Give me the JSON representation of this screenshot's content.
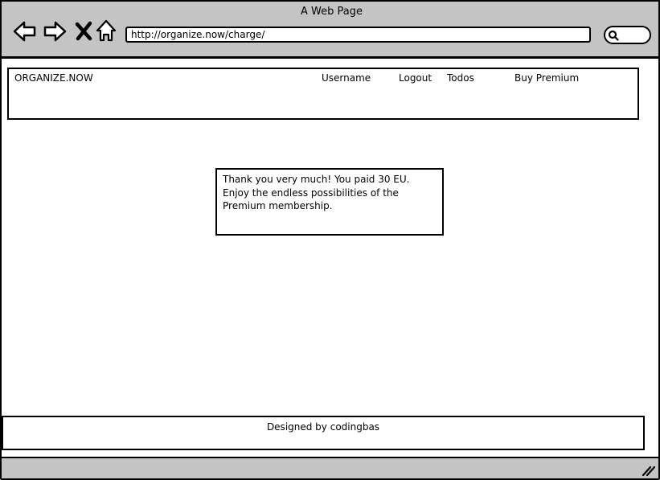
{
  "window": {
    "title": "A Web Page"
  },
  "browser": {
    "url": "http://organize.now/charge/",
    "icons": [
      "back-arrow-icon",
      "forward-arrow-icon",
      "close-icon",
      "home-icon",
      "search-icon"
    ]
  },
  "header": {
    "brand": "ORGANIZE.NOW",
    "nav": {
      "username": "Username",
      "logout": "Logout",
      "todos": "Todos",
      "premium": "Buy Premium"
    }
  },
  "message": {
    "line1": "Thank you very much! You paid 30 EU.",
    "line2": "Enjoy the endless possibilities of the Premium membership."
  },
  "footer": {
    "text": "Designed by codingbas"
  }
}
